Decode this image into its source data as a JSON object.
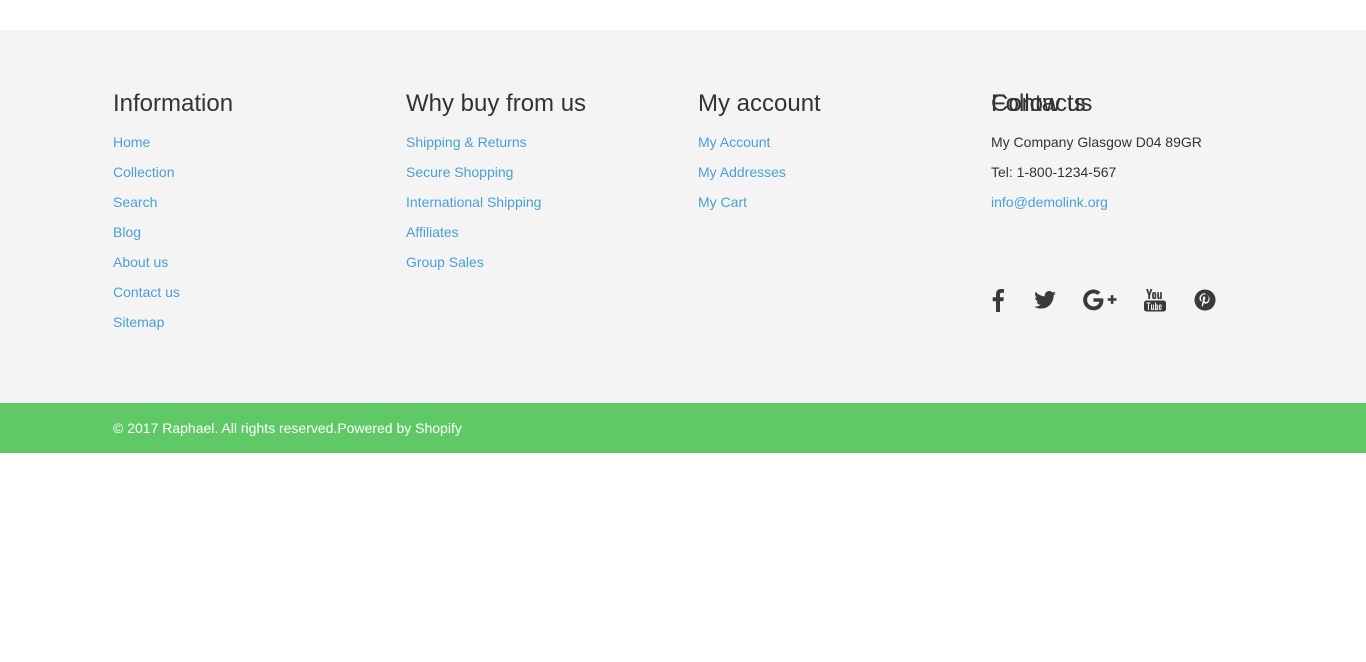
{
  "footer": {
    "information": {
      "title": "Information",
      "links": [
        "Home",
        "Collection",
        "Search",
        "Blog",
        "About us",
        "Contact us",
        "Sitemap"
      ]
    },
    "why_buy": {
      "title": "Why buy from us",
      "links": [
        "Shipping & Returns",
        "Secure Shopping",
        "International Shipping",
        "Affiliates",
        "Group Sales"
      ]
    },
    "my_account": {
      "title": "My account",
      "links": [
        "My Account",
        "My Addresses",
        "My Cart"
      ]
    },
    "contacts": {
      "title": "Contacts",
      "address": "My Company Glasgow D04 89GR",
      "phone": "Tel: 1-800-1234-567",
      "email": "info@demolink.org"
    },
    "follow": {
      "title": "Follow us",
      "icons": [
        "facebook-icon",
        "twitter-icon",
        "google-plus-icon",
        "youtube-icon",
        "pinterest-icon"
      ]
    }
  },
  "bottom_bar": {
    "copyright": "© 2017 Raphael. All rights reserved.",
    "powered": "Powered by Shopify"
  },
  "colors": {
    "link": "#4a9fd4",
    "footer_bg": "#f4f4f4",
    "bottom_bar_bg": "#5fca65",
    "heading": "#333333",
    "social_icon": "#3a3a3a"
  }
}
